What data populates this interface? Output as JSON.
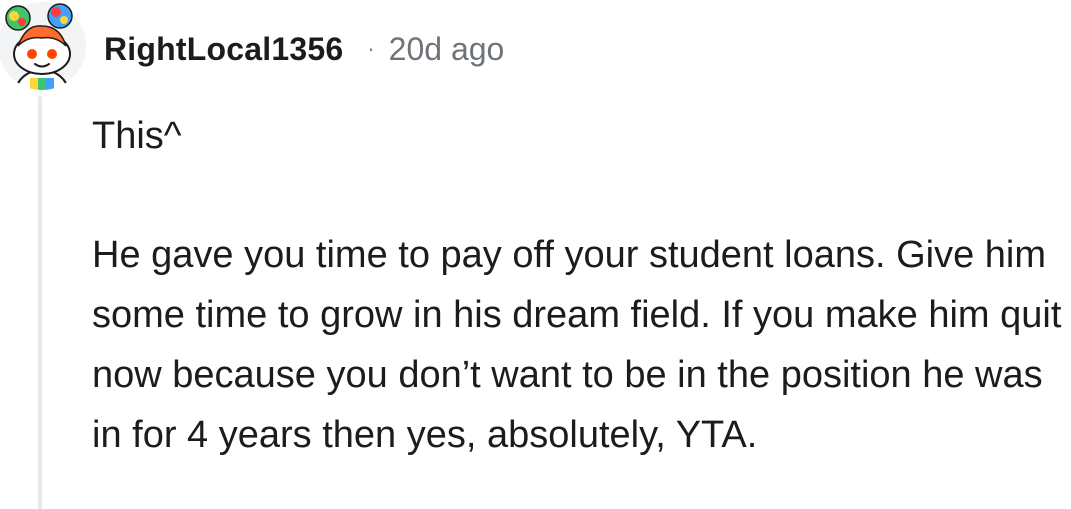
{
  "comment": {
    "username": "RightLocal1356",
    "separator": "·",
    "timestamp": "20d ago",
    "paragraphs": [
      "This^",
      "He gave you time to pay off your student loans. Give him some time to grow in his dream field. If you make him quit now because you don’t want to be in the position he was in for 4 years then yes, absolutely, YTA."
    ]
  },
  "avatar": {
    "icon": "snoo-avatar-icon",
    "colors": {
      "face": "#ffffff",
      "eyes": "#ff4500",
      "hair": "#ff6b2e",
      "bow_green": "#3ec76a",
      "bow_blue": "#3fa0ff",
      "bow_yellow": "#ffd635",
      "bow_red": "#ff3b3b"
    }
  },
  "colors": {
    "text": "#1c1c1c",
    "muted": "#6f7479",
    "thread_line": "#e5e7e9"
  }
}
